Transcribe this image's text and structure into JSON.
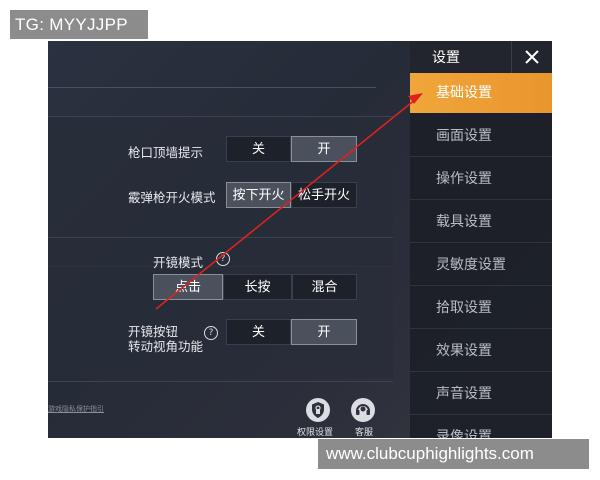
{
  "watermarks": {
    "top": "TG: MYYJJPP",
    "bottom": "www.clubcuphighlights.com"
  },
  "settings": {
    "muzzle_hint": {
      "label": "枪口顶墙提示",
      "options": [
        "关",
        "开"
      ],
      "selected": "开"
    },
    "shotgun_mode": {
      "label": "霰弹枪开火模式",
      "options": [
        "按下开火",
        "松手开火"
      ],
      "selected": "按下开火"
    },
    "scope_mode": {
      "label": "开镜模式",
      "help": "?",
      "options": [
        "点击",
        "长按",
        "混合"
      ],
      "selected": "点击"
    },
    "scope_view": {
      "label_line1": "开镜按钮",
      "label_line2": "转动视角功能",
      "help": "?",
      "options": [
        "关",
        "开"
      ],
      "selected": "开"
    }
  },
  "sidebar": {
    "title": "设置",
    "close": "×",
    "items": [
      {
        "label": "基础设置",
        "active": true
      },
      {
        "label": "画面设置",
        "active": false
      },
      {
        "label": "操作设置",
        "active": false
      },
      {
        "label": "载具设置",
        "active": false
      },
      {
        "label": "灵敏度设置",
        "active": false
      },
      {
        "label": "拾取设置",
        "active": false
      },
      {
        "label": "效果设置",
        "active": false
      },
      {
        "label": "声音设置",
        "active": false
      },
      {
        "label": "录像设置",
        "active": false
      }
    ]
  },
  "bottom": {
    "privacy_link": "游戏隐私保护指引",
    "permission_label": "权限设置",
    "service_label": "客服"
  },
  "colors": {
    "accent": "#f0a63a",
    "annotation_arrow": "#e02020"
  }
}
